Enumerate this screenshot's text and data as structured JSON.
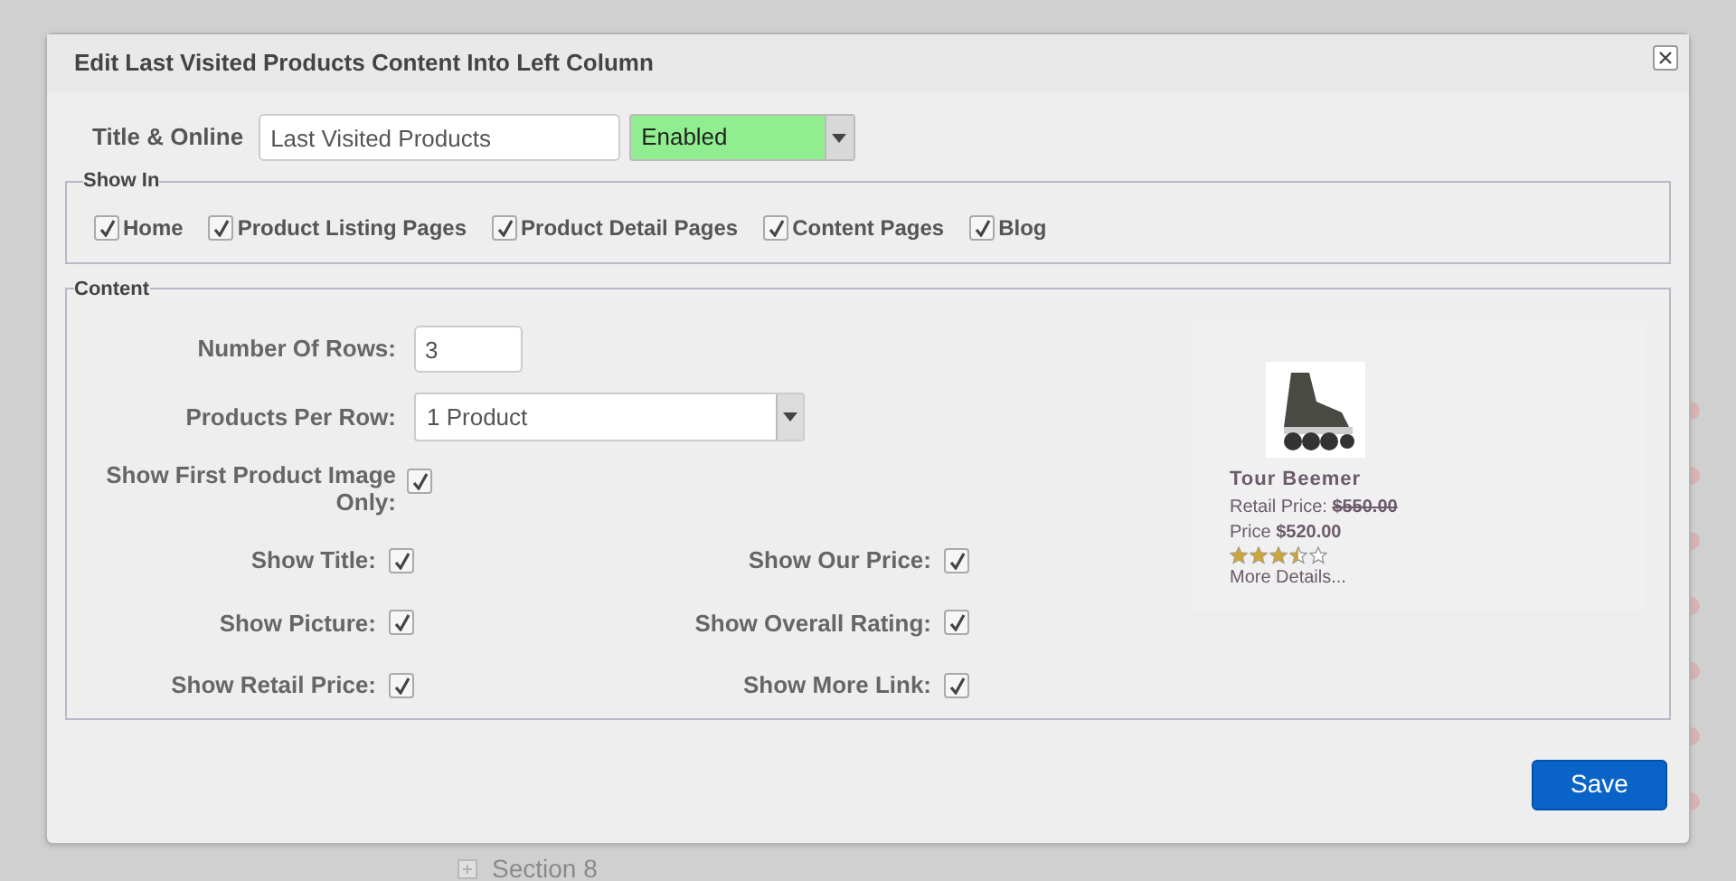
{
  "background": {
    "section_label": "Section 8"
  },
  "dialog": {
    "title": "Edit Last Visited Products Content Into Left Column"
  },
  "title_online": {
    "label": "Title & Online",
    "title_value": "Last Visited Products",
    "status": "Enabled"
  },
  "show_in": {
    "legend": "Show In",
    "items": [
      {
        "label": "Home",
        "checked": true
      },
      {
        "label": "Product Listing Pages",
        "checked": true
      },
      {
        "label": "Product Detail Pages",
        "checked": true
      },
      {
        "label": "Content Pages",
        "checked": true
      },
      {
        "label": "Blog",
        "checked": true
      }
    ]
  },
  "content": {
    "legend": "Content",
    "rows_label": "Number Of Rows:",
    "rows_value": "3",
    "per_row_label": "Products Per Row:",
    "per_row_value": "1 Product",
    "first_image": {
      "label": "Show First Product Image Only:",
      "checked": true
    },
    "options": [
      {
        "label": "Show Title:",
        "checked": true
      },
      {
        "label": "Show Our Price:",
        "checked": true
      },
      {
        "label": "Show Picture:",
        "checked": true
      },
      {
        "label": "Show Overall Rating:",
        "checked": true
      },
      {
        "label": "Show Retail Price:",
        "checked": true
      },
      {
        "label": "Show More Link:",
        "checked": true
      }
    ]
  },
  "preview": {
    "name": "Tour Beemer",
    "retail_label": "Retail Price:",
    "retail_value": "$550.00",
    "price_label": "Price",
    "price_value": "$520.00",
    "stars": 3.5,
    "more_link": "More Details..."
  },
  "save_button": "Save"
}
